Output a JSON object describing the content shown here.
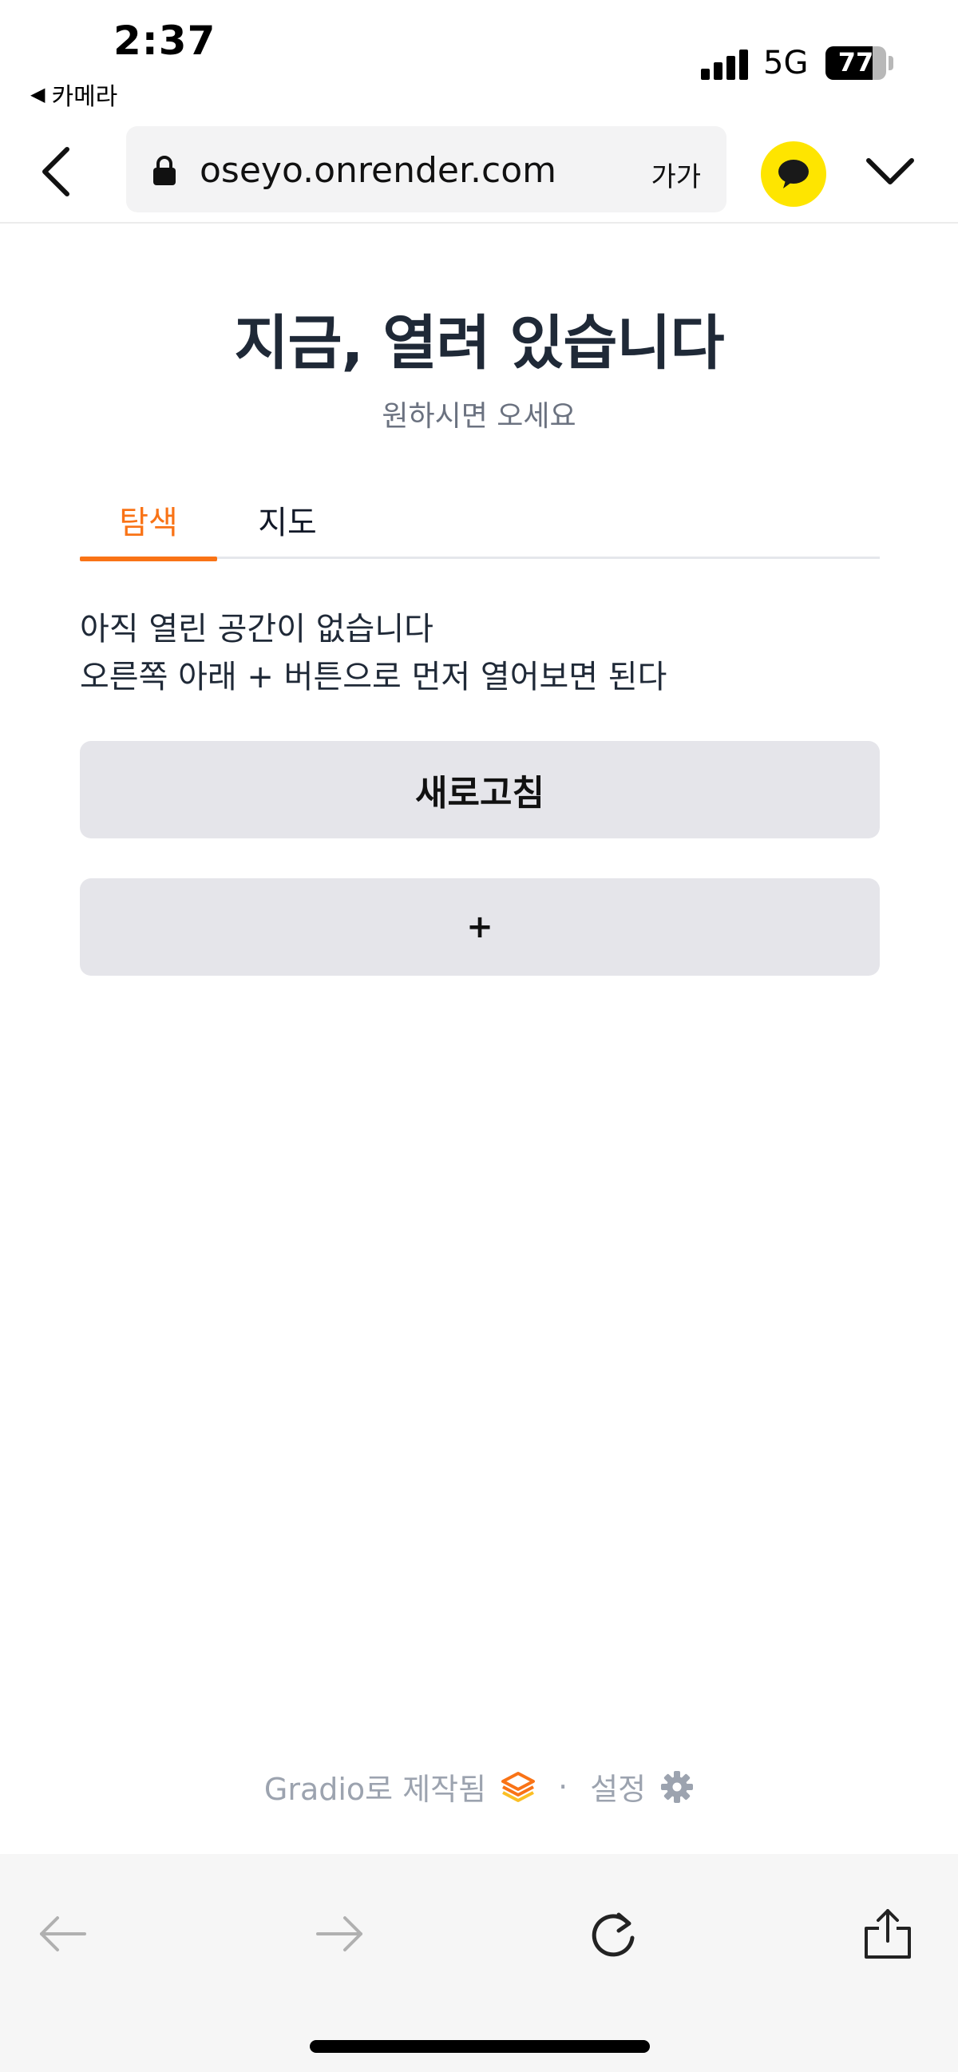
{
  "status_bar": {
    "time": "2:37",
    "back_app": "카메라",
    "network": "5G",
    "battery_percent": "77",
    "battery_level": 0.77
  },
  "browser": {
    "url": "oseyo.onrender.com",
    "text_size_label": "가가",
    "icons": {
      "back": "chevron-left-icon",
      "lock": "lock-icon",
      "kakao": "kakaotalk-icon",
      "menu": "chevron-down-icon"
    },
    "kakao_color": "#fee500"
  },
  "page": {
    "title": "지금, 열려 있습니다",
    "subtitle": "원하시면 오세요",
    "tabs": [
      {
        "label": "탐색",
        "active": true
      },
      {
        "label": "지도",
        "active": false
      }
    ],
    "accent_color": "#f97316",
    "empty_message_line1": "아직 열린 공간이 없습니다",
    "empty_message_line2": "오른쪽 아래 + 버튼으로 먼저 열어보면 된다",
    "refresh_button": "새로고침",
    "add_button": "+"
  },
  "footer": {
    "made_with": "Gradio로 제작됨",
    "separator": "·",
    "settings": "설정"
  },
  "bottom_bar": {
    "icons": [
      "arrow-left-icon",
      "arrow-right-icon",
      "reload-icon",
      "share-icon"
    ]
  }
}
